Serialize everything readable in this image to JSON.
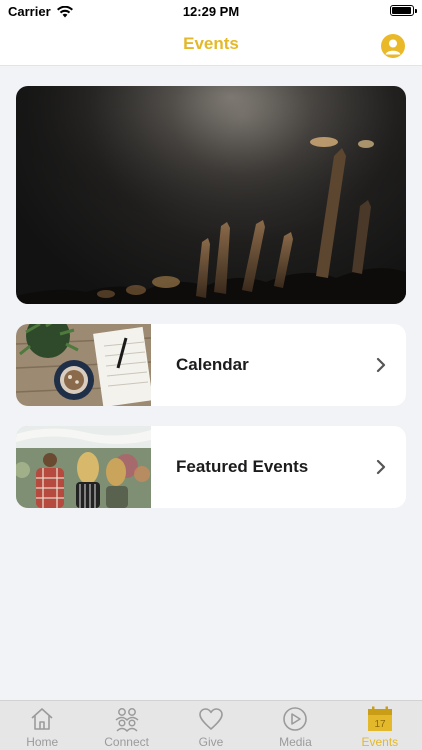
{
  "status_bar": {
    "carrier": "Carrier",
    "time": "12:29 PM"
  },
  "nav": {
    "title": "Events",
    "profile_icon": "person-icon"
  },
  "hero": {
    "image": "concert-crowd-image"
  },
  "cards": [
    {
      "label": "Calendar",
      "image": "planner-and-coffee-image"
    },
    {
      "label": "Featured Events",
      "image": "outdoor-market-image"
    }
  ],
  "tab_bar": {
    "tabs": [
      {
        "label": "Home",
        "icon": "house-icon",
        "active": false
      },
      {
        "label": "Connect",
        "icon": "people-icon",
        "active": false
      },
      {
        "label": "Give",
        "icon": "heart-icon",
        "active": false
      },
      {
        "label": "Media",
        "icon": "play-icon",
        "active": false
      },
      {
        "label": "Events",
        "icon": "calendar-icon",
        "active": true,
        "badge_day": "17"
      }
    ]
  },
  "colors": {
    "accent": "#e3b92b",
    "inactive": "#9b9b9b",
    "background": "#f2f3f7"
  }
}
